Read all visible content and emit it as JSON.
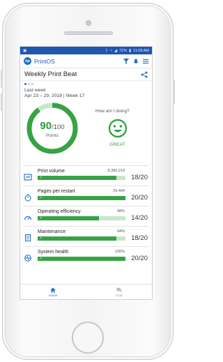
{
  "status_bar": {
    "time": "11:09 AM",
    "battery": "71%"
  },
  "app": {
    "name": "PrintOS",
    "logo_text": "hp"
  },
  "card": {
    "title": "Weekly Print Beat",
    "period_label": "Last week",
    "period_range": "Apr 23 – 29, 2018 | Week 17",
    "score": {
      "value": "90",
      "total": "/100",
      "label": "Points",
      "fraction": 0.9
    },
    "question": "How am I doing?",
    "mood": "GREAT"
  },
  "metrics": [
    {
      "name": "Print volume",
      "raw": "8,380,219",
      "score": "18/20",
      "fraction": 0.9,
      "icon": "print-volume-icon"
    },
    {
      "name": "Pages per restart",
      "raw": "29,404",
      "score": "20/20",
      "fraction": 1.0,
      "icon": "stopwatch-icon"
    },
    {
      "name": "Operating efficiency",
      "raw": "48%",
      "score": "14/20",
      "fraction": 0.7,
      "icon": "speedometer-icon"
    },
    {
      "name": "Maintenance",
      "raw": "94%",
      "score": "18/20",
      "fraction": 0.9,
      "icon": "maintenance-icon"
    },
    {
      "name": "System health",
      "raw": "100%",
      "score": "20/20",
      "fraction": 1.0,
      "icon": "system-health-icon"
    }
  ],
  "nav": [
    {
      "label": "Home",
      "icon": "home-icon",
      "active": true
    },
    {
      "label": "Chat",
      "icon": "chat-icon",
      "active": false
    }
  ],
  "colors": {
    "brand_blue": "#1f56b0",
    "accent_green": "#36a345",
    "light_green": "#c7e7cb"
  }
}
